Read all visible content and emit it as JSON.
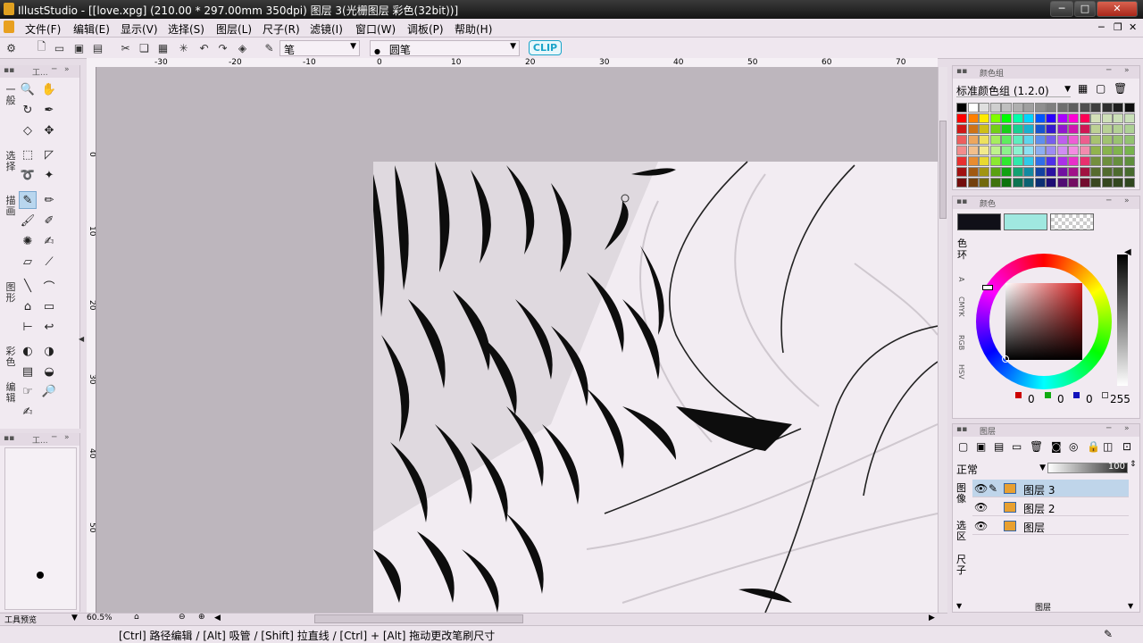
{
  "window": {
    "title": "IllustStudio - [[love.xpg] (210.00 * 297.00mm 350dpi)  图层 3(光栅图层 彩色(32bit))]",
    "min_label": "─",
    "max_label": "□",
    "close_label": "✕"
  },
  "menu": [
    {
      "label": "文件(F)"
    },
    {
      "label": "编辑(E)"
    },
    {
      "label": "显示(V)"
    },
    {
      "label": "选择(S)"
    },
    {
      "label": "图层(L)"
    },
    {
      "label": "尺子(R)"
    },
    {
      "label": "滤镜(I)"
    },
    {
      "label": "窗口(W)"
    },
    {
      "label": "调板(P)"
    },
    {
      "label": "帮助(H)"
    }
  ],
  "toolbar": {
    "tool_select": "笔",
    "brush_select": "圆笔",
    "brush_dot": "●",
    "badge": "CLIP"
  },
  "ruler": {
    "h_ticks": [
      "-30",
      "-20",
      "-10",
      "0",
      "10",
      "20",
      "30",
      "40",
      "50",
      "60",
      "70"
    ],
    "v_ticks": [
      "0",
      "10",
      "20",
      "30",
      "40",
      "50"
    ]
  },
  "tool_panel": {
    "title": "工...",
    "categories": [
      {
        "label": "一般"
      },
      {
        "label": "选择"
      },
      {
        "label": "描画"
      },
      {
        "label": "图形"
      },
      {
        "label": "彩色"
      },
      {
        "label": "编辑"
      }
    ]
  },
  "brush_panel": {
    "title": "工...",
    "footer": "工具预览"
  },
  "zoom": "60.5%",
  "status_text": "[Ctrl] 路径编辑 / [Alt] 吸管 / [Shift] 拉直线 / [Ctrl] + [Alt] 拖动更改笔刷尺寸",
  "palette_panel": {
    "title": "颜色组",
    "set_name": "标准颜色组 (1.2.0)"
  },
  "color_panel": {
    "title": "颜色",
    "label_ring": "色环",
    "mode_tabs": [
      "A",
      "CMYK",
      "RGB",
      "HSV"
    ],
    "rgb": {
      "r": "0",
      "g": "0",
      "b": "0",
      "a": "255"
    },
    "main_color": "#101018",
    "sub_color": "#a0e8e0"
  },
  "layer_panel": {
    "title": "图层",
    "blend": "正常",
    "opacity": "100",
    "side_tabs": [
      "图像",
      "选区",
      "尺子"
    ],
    "footer": "图层",
    "layers": [
      {
        "name": "图层 3",
        "selected": true
      },
      {
        "name": "图层 2",
        "selected": false
      },
      {
        "name": "图层",
        "selected": false
      }
    ]
  }
}
